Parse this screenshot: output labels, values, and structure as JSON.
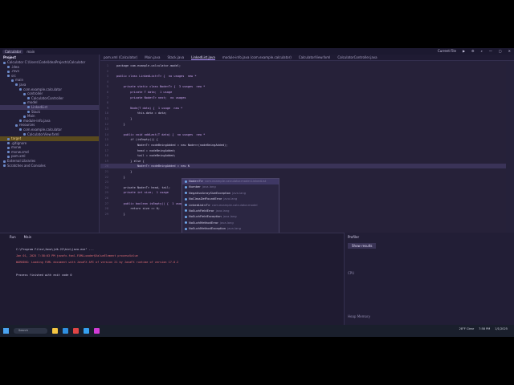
{
  "window": {
    "title": "Calculator",
    "branch": "main",
    "run_config": "Current File"
  },
  "project": {
    "header": "Project",
    "tree": [
      {
        "label": "Calculator  C:\\Users\\Code\\IdeaProjects\\Calculator",
        "sel": false
      },
      {
        "label": ".idea",
        "sel": false
      },
      {
        "label": ".mvn",
        "sel": false
      },
      {
        "label": "src",
        "sel": false
      },
      {
        "label": "main",
        "sel": false
      },
      {
        "label": "java",
        "sel": false
      },
      {
        "label": "com.example.calculator",
        "sel": false
      },
      {
        "label": "controller",
        "sel": false
      },
      {
        "label": "CalculatorController",
        "sel": false
      },
      {
        "label": "model",
        "sel": false
      },
      {
        "label": "LinkedList",
        "sel": true
      },
      {
        "label": "Stack",
        "sel": false
      },
      {
        "label": "Main",
        "sel": false
      },
      {
        "label": "module-info.java",
        "sel": false
      },
      {
        "label": "resources",
        "sel": false
      },
      {
        "label": "com.example.calculator",
        "sel": false
      },
      {
        "label": "CalculatorView.fxml",
        "sel": false
      },
      {
        "label": "target",
        "sel": "orange"
      },
      {
        "label": ".gitignore",
        "sel": false
      },
      {
        "label": "mvnw",
        "sel": false
      },
      {
        "label": "mvnw.cmd",
        "sel": false
      },
      {
        "label": "pom.xml",
        "sel": false
      },
      {
        "label": "External Libraries",
        "sel": false
      },
      {
        "label": "Scratches and Consoles",
        "sel": false
      }
    ]
  },
  "tabs": [
    {
      "label": "pom.xml (Calculator)",
      "active": false
    },
    {
      "label": "Main.java",
      "active": false
    },
    {
      "label": "Stack.java",
      "active": false
    },
    {
      "label": "LinkedList.java",
      "active": true
    },
    {
      "label": "module-info.java (com.example.calculator)",
      "active": false
    },
    {
      "label": "CalculatorView.fxml",
      "active": false
    },
    {
      "label": "CalculatorController.java",
      "active": false
    }
  ],
  "editor": {
    "current_line": "22",
    "lines": [
      {
        "n": "1",
        "t": "package com.example.calculator.model;"
      },
      {
        "n": "2",
        "t": ""
      },
      {
        "n": "3",
        "t": "public class LinkedList<T> {  no usages  new *"
      },
      {
        "n": "4",
        "t": ""
      },
      {
        "n": "5",
        "t": "    private static class Node<T> {  3 usages  new *"
      },
      {
        "n": "6",
        "t": "        private T data;  1 usage"
      },
      {
        "n": "7",
        "t": "        private Node<T> next;  no usages"
      },
      {
        "n": "8",
        "t": ""
      },
      {
        "n": "9",
        "t": "        Node(T data) {  1 usage  new *"
      },
      {
        "n": "10",
        "t": "            this.data = data;"
      },
      {
        "n": "11",
        "t": "        }"
      },
      {
        "n": "12",
        "t": "    }"
      },
      {
        "n": "13",
        "t": ""
      },
      {
        "n": "14",
        "t": "    public void addLast(T data) {  no usages  new *"
      },
      {
        "n": "15",
        "t": "        if (isEmpty()) {"
      },
      {
        "n": "16",
        "t": "            Node<T> nodeBeingAdded = new Node<>(nodeBeingAdded);"
      },
      {
        "n": "17",
        "t": "            head = nodeBeingAdded;"
      },
      {
        "n": "18",
        "t": "            tail = nodeBeingAdded;"
      },
      {
        "n": "19",
        "t": "        } else {"
      },
      {
        "n": "20",
        "t": "            Node<T> nodeBeingAdded = new N"
      },
      {
        "n": "21",
        "t": "        }"
      },
      {
        "n": "22",
        "t": "    }"
      },
      {
        "n": "23",
        "t": ""
      },
      {
        "n": "24",
        "t": "    private Node<T> head, tail;"
      },
      {
        "n": "25",
        "t": "    private int size;  1 usage"
      },
      {
        "n": "26",
        "t": ""
      },
      {
        "n": "27",
        "t": "    public boolean isEmpty() {  1 usage"
      },
      {
        "n": "28",
        "t": "        return size == 0;"
      },
      {
        "n": "29",
        "t": "    }"
      }
    ]
  },
  "autocomplete": {
    "items": [
      {
        "name": "Node<T>",
        "pkg": "com.example.calculator.model.LinkedList",
        "sel": true
      },
      {
        "name": "Number",
        "pkg": "java.lang",
        "sel": false
      },
      {
        "name": "NegativeArraySizeException",
        "pkg": "java.lang",
        "sel": false
      },
      {
        "name": "NoClassDefFoundError",
        "pkg": "java.lang",
        "sel": false
      },
      {
        "name": "LinkedList<T>",
        "pkg": "com.example.calculator.model",
        "sel": false
      },
      {
        "name": "NoSuchFieldError",
        "pkg": "java.lang",
        "sel": false
      },
      {
        "name": "NoSuchFieldException",
        "pkg": "java.lang",
        "sel": false
      },
      {
        "name": "NoSuchMethodError",
        "pkg": "java.lang",
        "sel": false
      },
      {
        "name": "NoSuchMethodException",
        "pkg": "java.lang",
        "sel": false
      },
      {
        "name": "NullPointerException",
        "pkg": "java.lang",
        "sel": false
      },
      {
        "name": "NumberFormatException",
        "pkg": "java.lang",
        "sel": false
      }
    ],
    "footer": "Press Ctrl+. to choose the selected (or first) suggestion and insert a dot afterwards"
  },
  "run": {
    "tab_run": "Run",
    "tab_main": "Main",
    "lines": [
      {
        "t": "C:\\Program Files\\Java\\jdk-22\\bin\\java.exe\" ...",
        "c": "#cfc9e6"
      },
      {
        "t": "Jan 01, 2025 7:58:03 PM javafx.fxml.FXMLLoader$ValueElement processValue",
        "c": "#e06c75"
      },
      {
        "t": "WARNING: Loading FXML document with JavaFX API of version 21 by JavaFX runtime of version 17.0.2",
        "c": "#e06c75"
      },
      {
        "t": "",
        "c": "#cfc9e6"
      },
      {
        "t": "Process finished with exit code 0",
        "c": "#cfc9e6"
      }
    ]
  },
  "profiler": {
    "header": "Profiler",
    "record_label": "Show results",
    "cpu_label": "CPU",
    "heap_label": "Heap Memory"
  },
  "status": {
    "breadcrumb": [
      "Calculator",
      "src",
      "main",
      "java",
      "com",
      "example",
      "calculator",
      "model",
      "LinkedList",
      "addLast"
    ],
    "position": "20:43",
    "line_sep": "CRLF",
    "encoding": "UTF-8",
    "indent": "4 spaces",
    "theme": "Synthwave '84 (Material)"
  },
  "taskbar": {
    "search_placeholder": "Search",
    "weather": "28°F Clear",
    "time": "7:58 PM",
    "date": "1/1/2025"
  }
}
